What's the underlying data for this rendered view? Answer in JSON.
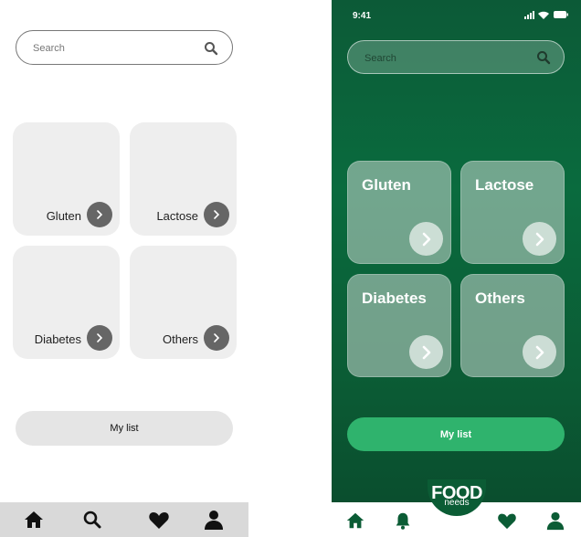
{
  "wireframe": {
    "search": {
      "placeholder": "Search"
    },
    "categories": [
      {
        "label": "Gluten"
      },
      {
        "label": "Lactose"
      },
      {
        "label": "Diabetes"
      },
      {
        "label": "Others"
      }
    ],
    "mylist_label": "My list",
    "nav": [
      "home-icon",
      "search-icon",
      "heart-icon",
      "user-icon"
    ]
  },
  "app": {
    "status": {
      "time": "9:41"
    },
    "search": {
      "placeholder": "Search"
    },
    "categories": [
      {
        "label": "Gluten"
      },
      {
        "label": "Lactose"
      },
      {
        "label": "Diabetes"
      },
      {
        "label": "Others"
      }
    ],
    "mylist_label": "My list",
    "logo": {
      "food": "FOOD",
      "needs": "needs"
    },
    "nav": [
      "home-icon",
      "bell-icon",
      "heart-icon",
      "user-icon"
    ],
    "colors": {
      "background": "#0a6b3e",
      "primary_button": "#2fb36d",
      "card": "#c8d7d0"
    }
  }
}
